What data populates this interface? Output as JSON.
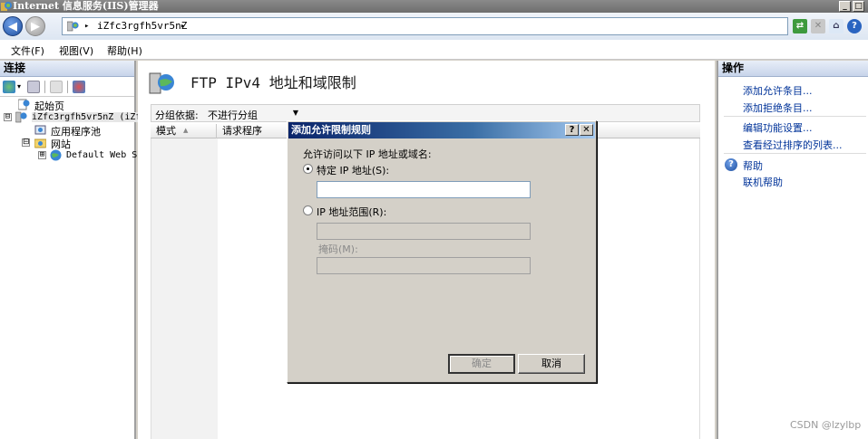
{
  "window": {
    "title": "Internet 信息服务(IIS)管理器",
    "buttons": [
      "_",
      "□"
    ]
  },
  "navigation": {
    "address_segments": [
      "iZfc3rgfh5vr5nZ"
    ],
    "separator": "▸"
  },
  "menu": {
    "items": [
      "文件(F)",
      "视图(V)",
      "帮助(H)"
    ]
  },
  "connections": {
    "header": "连接",
    "tree": [
      {
        "label": "起始页",
        "level": 1
      },
      {
        "label": "iZfc3rgfh5vr5nZ (iZf",
        "level": 0,
        "expander": "⊟"
      },
      {
        "label": "应用程序池",
        "level": 1
      },
      {
        "label": "网站",
        "level": 1,
        "expander": "⊟"
      },
      {
        "label": "Default Web S:",
        "level": 2,
        "expander": "⊞"
      }
    ]
  },
  "feature": {
    "title": "FTP IPv4 地址和域限制",
    "group_label": "分组依据:",
    "group_value": "不进行分组",
    "columns": [
      "模式",
      "请求程序"
    ]
  },
  "actions": {
    "header": "操作",
    "items": [
      "添加允许条目...",
      "添加拒绝条目...",
      "编辑功能设置...",
      "查看经过排序的列表..."
    ],
    "help_items": [
      "帮助",
      "联机帮助"
    ]
  },
  "dialog": {
    "title": "添加允许限制规则",
    "title_buttons": [
      "?",
      "✕"
    ],
    "prompt": "允许访问以下 IP 地址或域名:",
    "option_specific": "特定 IP 地址(S):",
    "option_range": "IP 地址范围(R):",
    "mask_label": "掩码(M):",
    "specific_value": "",
    "range_value": "",
    "mask_value": "",
    "ok_label": "确定",
    "cancel_label": "取消"
  },
  "watermark": "CSDN @lzylbp",
  "colors": {
    "dialog_title": "#0a246a",
    "link": "#003399",
    "panel_header": "#c7d4ea"
  }
}
